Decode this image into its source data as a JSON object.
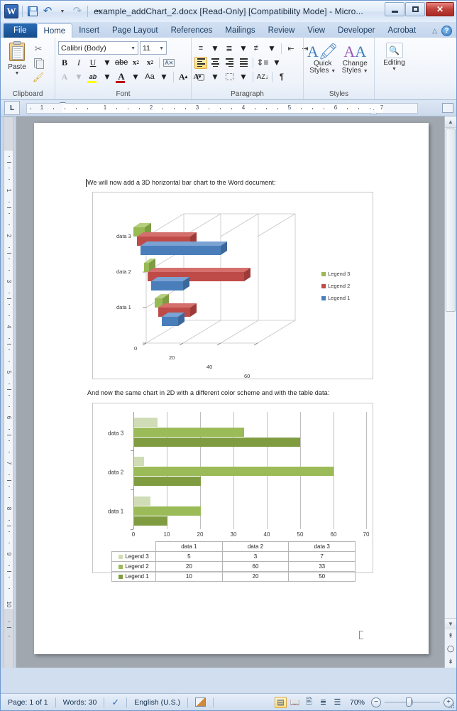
{
  "window": {
    "title": "example_addChart_2.docx [Read-Only] [Compatibility Mode]  -  Micro...",
    "app_icon": "word-logo",
    "minimize_label": "Minimize",
    "maximize_label": "Restore",
    "close_label": "Close"
  },
  "quick_access": {
    "save_label": "Save",
    "undo_label": "Undo",
    "redo_label": "Redo",
    "customize_label": "Customize Quick Access Toolbar"
  },
  "tabs": [
    {
      "label": "File",
      "active": false
    },
    {
      "label": "Home",
      "active": true
    },
    {
      "label": "Insert",
      "active": false
    },
    {
      "label": "Page Layout",
      "active": false
    },
    {
      "label": "References",
      "active": false
    },
    {
      "label": "Mailings",
      "active": false
    },
    {
      "label": "Review",
      "active": false
    },
    {
      "label": "View",
      "active": false
    },
    {
      "label": "Developer",
      "active": false
    },
    {
      "label": "Acrobat",
      "active": false
    }
  ],
  "ribbon": {
    "groups": [
      {
        "name": "Clipboard",
        "label": "Clipboard"
      },
      {
        "name": "Font",
        "label": "Font"
      },
      {
        "name": "Paragraph",
        "label": "Paragraph"
      },
      {
        "name": "Styles",
        "label": "Styles"
      },
      {
        "name": "Editing",
        "label": "Editing"
      }
    ],
    "clipboard": {
      "paste_label": "Paste",
      "cut_label": "Cut",
      "copy_label": "Copy",
      "format_painter_label": "Format Painter"
    },
    "font": {
      "font_name": "Calibri (Body)",
      "font_size": "11",
      "bold_label": "B",
      "italic_label": "I",
      "underline_label": "U",
      "strike_label": "abe",
      "subscript_label": "x",
      "superscript_label": "x",
      "clear_formatting_label": "Clear Formatting",
      "text_effects_label": "A",
      "highlight_label": "ab",
      "font_color_label": "A",
      "change_case_label": "Aa",
      "grow_font_label": "A",
      "shrink_font_label": "A"
    },
    "paragraph": {
      "bullets_label": "Bullets",
      "numbering_label": "Numbering",
      "multilevel_label": "Multilevel List",
      "decrease_indent_label": "Decrease Indent",
      "increase_indent_label": "Increase Indent",
      "line_spacing_label": "Line and Paragraph Spacing",
      "align_left_label": "Align Left",
      "align_center_label": "Center",
      "align_right_label": "Align Right",
      "justify_label": "Justify",
      "shading_label": "Shading",
      "borders_label": "Borders",
      "sort_label": "Sort",
      "show_marks_label": "¶"
    },
    "styles": {
      "quick_styles_label": "Quick",
      "quick_styles_label2": "Styles",
      "change_styles_label": "Change",
      "change_styles_label2": "Styles"
    },
    "editing": {
      "label": "Editing"
    }
  },
  "ruler": {
    "tab_selector": "L",
    "horizontal_marks": [
      "1",
      "",
      "1",
      "2",
      "3",
      "4",
      "5",
      "6",
      "7"
    ]
  },
  "document": {
    "paragraph_1": "We will now add a 3D horizontal bar chart to the Word document:",
    "paragraph_2": "And now the same chart in 2D with a different color scheme and with the table data:"
  },
  "chart_data": [
    {
      "type": "bar",
      "render": "3d-horizontal",
      "title": "",
      "categories": [
        "data 1",
        "data 2",
        "data 3"
      ],
      "series": [
        {
          "name": "Legend 1",
          "values": [
            10,
            20,
            50
          ],
          "color": "#4a7ebb"
        },
        {
          "name": "Legend 2",
          "values": [
            20,
            60,
            33
          ],
          "color": "#be4b48"
        },
        {
          "name": "Legend 3",
          "values": [
            5,
            3,
            7
          ],
          "color": "#98b954"
        }
      ],
      "xlabel": "",
      "ylabel": "",
      "xticks": [
        "0",
        "20",
        "40",
        "60"
      ],
      "xlim": [
        0,
        70
      ],
      "grid": true,
      "legend_position": "right",
      "legend_entries": [
        "Legend 3",
        "Legend 2",
        "Legend 1"
      ]
    },
    {
      "type": "bar",
      "render": "2d-horizontal",
      "title": "",
      "categories": [
        "data 1",
        "data 2",
        "data 3"
      ],
      "series": [
        {
          "name": "Legend 1",
          "values": [
            10,
            20,
            50
          ],
          "color": "#7f9c41"
        },
        {
          "name": "Legend 2",
          "values": [
            20,
            60,
            33
          ],
          "color": "#9bbb59"
        },
        {
          "name": "Legend 3",
          "values": [
            5,
            3,
            7
          ],
          "color": "#d0dcb5"
        }
      ],
      "xlabel": "",
      "ylabel": "",
      "xticks": [
        "0",
        "10",
        "20",
        "30",
        "40",
        "50",
        "60",
        "70"
      ],
      "xlim": [
        0,
        70
      ],
      "grid": true,
      "legend_position": "table",
      "data_table": {
        "columns": [
          "",
          "data 1",
          "data 2",
          "data 3"
        ],
        "rows": [
          {
            "label": "Legend 3",
            "swatch": "#d0dcb5",
            "values": [
              "5",
              "3",
              "7"
            ]
          },
          {
            "label": "Legend 2",
            "swatch": "#9bbb59",
            "values": [
              "20",
              "60",
              "33"
            ]
          },
          {
            "label": "Legend 1",
            "swatch": "#7f9c41",
            "values": [
              "10",
              "20",
              "50"
            ]
          }
        ]
      }
    }
  ],
  "status_bar": {
    "page": "Page: 1 of 1",
    "words": "Words: 30",
    "spelling_label": "Proofing errors",
    "language": "English (U.S.)",
    "macro_label": "Macro Recording",
    "view_print_layout": "Print Layout",
    "view_full_screen": "Full Screen Reading",
    "view_web_layout": "Web Layout",
    "view_outline": "Outline",
    "view_draft": "Draft",
    "zoom": "70%",
    "zoom_out_label": "−",
    "zoom_in_label": "+"
  },
  "scrollbar": {
    "up_label": "▲",
    "down_label": "▼",
    "prev_page_label": "Previous Page",
    "select_browse_label": "Select Browse Object",
    "next_page_label": "Next Page"
  },
  "colors": {
    "accent_blue": "#2a6bb5",
    "series_blue": "#4a7ebb",
    "series_red": "#be4b48",
    "series_green": "#98b954",
    "green_light": "#d0dcb5",
    "green_mid": "#9bbb59",
    "green_dark": "#7f9c41"
  }
}
